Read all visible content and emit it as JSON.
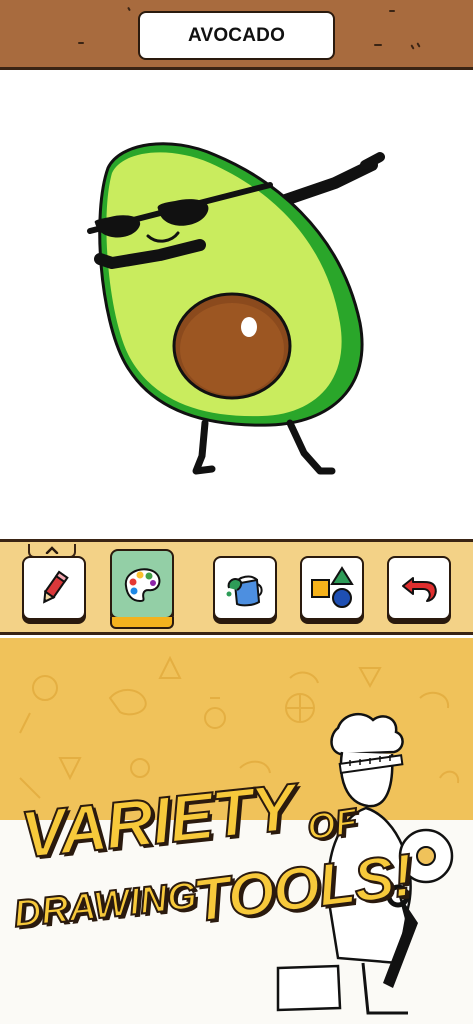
{
  "header": {
    "title": "AVOCADO",
    "background_color": "#a86b3e"
  },
  "canvas": {
    "drawing": "avocado-dabbing-with-sunglasses"
  },
  "toolbar": {
    "handle_icon": "chevron-up-icon",
    "tools": [
      {
        "name": "pencil",
        "icon": "pencil-icon",
        "active": false
      },
      {
        "name": "palette",
        "icon": "palette-icon",
        "active": true
      },
      {
        "name": "paint-bucket",
        "icon": "paint-bucket-icon",
        "active": false
      },
      {
        "name": "shapes",
        "icon": "shapes-icon",
        "active": false
      },
      {
        "name": "undo",
        "icon": "undo-icon",
        "active": false
      }
    ],
    "background_color": "#f3d287",
    "active_color": "#93cfa6"
  },
  "promo": {
    "line1": "VARIETY",
    "line1_small": "OF",
    "line2_small": "DRAWING",
    "line2": "TOOLS!",
    "text_color": "#f7c93b",
    "background_color": "#f0c25a"
  }
}
